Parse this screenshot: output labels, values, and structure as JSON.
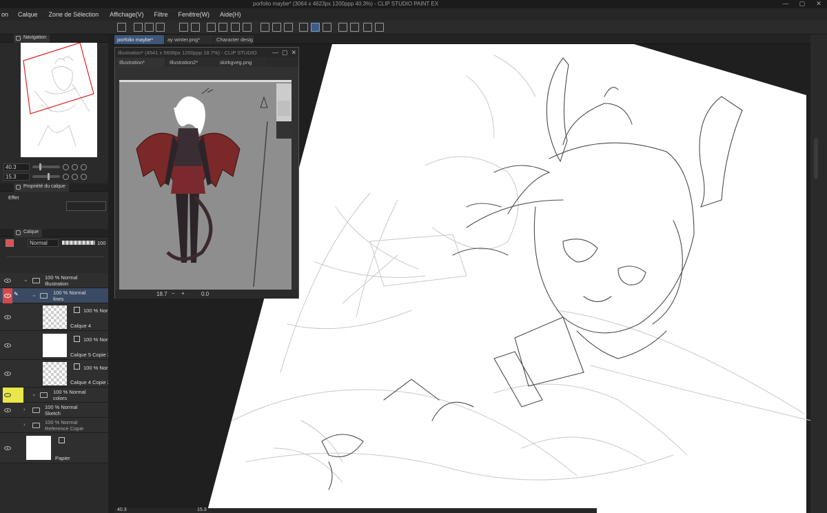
{
  "window": {
    "title": "porfolio maybe* (3064 x 4623px 1200ppp 40.3%) - CLIP STUDIO PAINT EX",
    "controls": [
      "—",
      "▢",
      "✕"
    ]
  },
  "menu": {
    "items": [
      "on",
      "Calque",
      "Zone de Sélection",
      "Affichage(V)",
      "Filtre",
      "Fenêtre(W)",
      "Aide(H)"
    ]
  },
  "navigator": {
    "tabs": [
      "Navigation"
    ],
    "zoom_value": "40.3",
    "rotate_value": "15.3"
  },
  "layer_property": {
    "tab": "Propriété du calque",
    "effect_label": "Effet"
  },
  "layer_panel": {
    "tab": "Calque",
    "blend_mode": "Normal",
    "opacity": "100",
    "layers": [
      {
        "line1": "100 % Normal",
        "line2": "Illustration"
      },
      {
        "line1": "100 % Normal",
        "line2": "lines"
      },
      {
        "line1": "100 % Normal",
        "line2": "Calque 4"
      },
      {
        "line1": "100 % Norr",
        "line2": "Calque 5 Copie 3"
      },
      {
        "line1": "100 % Norr",
        "line2": "Calque 4 Copie 2"
      },
      {
        "line1": "100 % Normal",
        "line2": "colors"
      },
      {
        "line1": "100 % Normal",
        "line2": "Sketch"
      },
      {
        "line1": "100 % Normal",
        "line2": "Reference Copie"
      },
      {
        "line1": "",
        "line2": "Papier"
      }
    ]
  },
  "doc_tabs": [
    "porfolio maybe*",
    "ay winter.png*",
    "Character desig"
  ],
  "sub_window": {
    "title": "Illustration* (4541 x 5608px 1200ppp 18.7%) - CLIP STUDIO",
    "tabs": [
      "Illustration*",
      "Illustration2*",
      "skirkgveg.png"
    ],
    "zoom": "18.7",
    "angle": "0.0"
  },
  "status": {
    "zoom": "40.3",
    "angle": "15.3"
  },
  "colors": {
    "accent": "#3d5679",
    "main_color": "#e05050",
    "highlight_yellow": "#e8e84a"
  }
}
